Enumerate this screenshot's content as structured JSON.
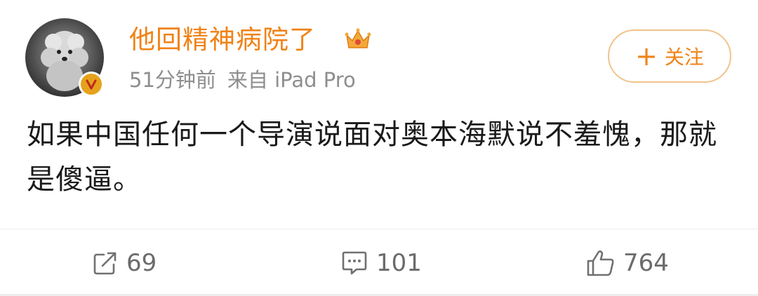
{
  "post": {
    "username": "他回精神病院了",
    "time": "51分钟前",
    "source": "来自 iPad Pro",
    "follow_label": "关注",
    "content": "如果中国任何一个导演说面对奥本海默说不羞愧，那就是傻逼。"
  },
  "actions": {
    "repost_count": "69",
    "comment_count": "101",
    "like_count": "764"
  },
  "colors": {
    "accent": "#f08216",
    "text": "#1a1a1a",
    "meta": "#8e8e8e"
  }
}
